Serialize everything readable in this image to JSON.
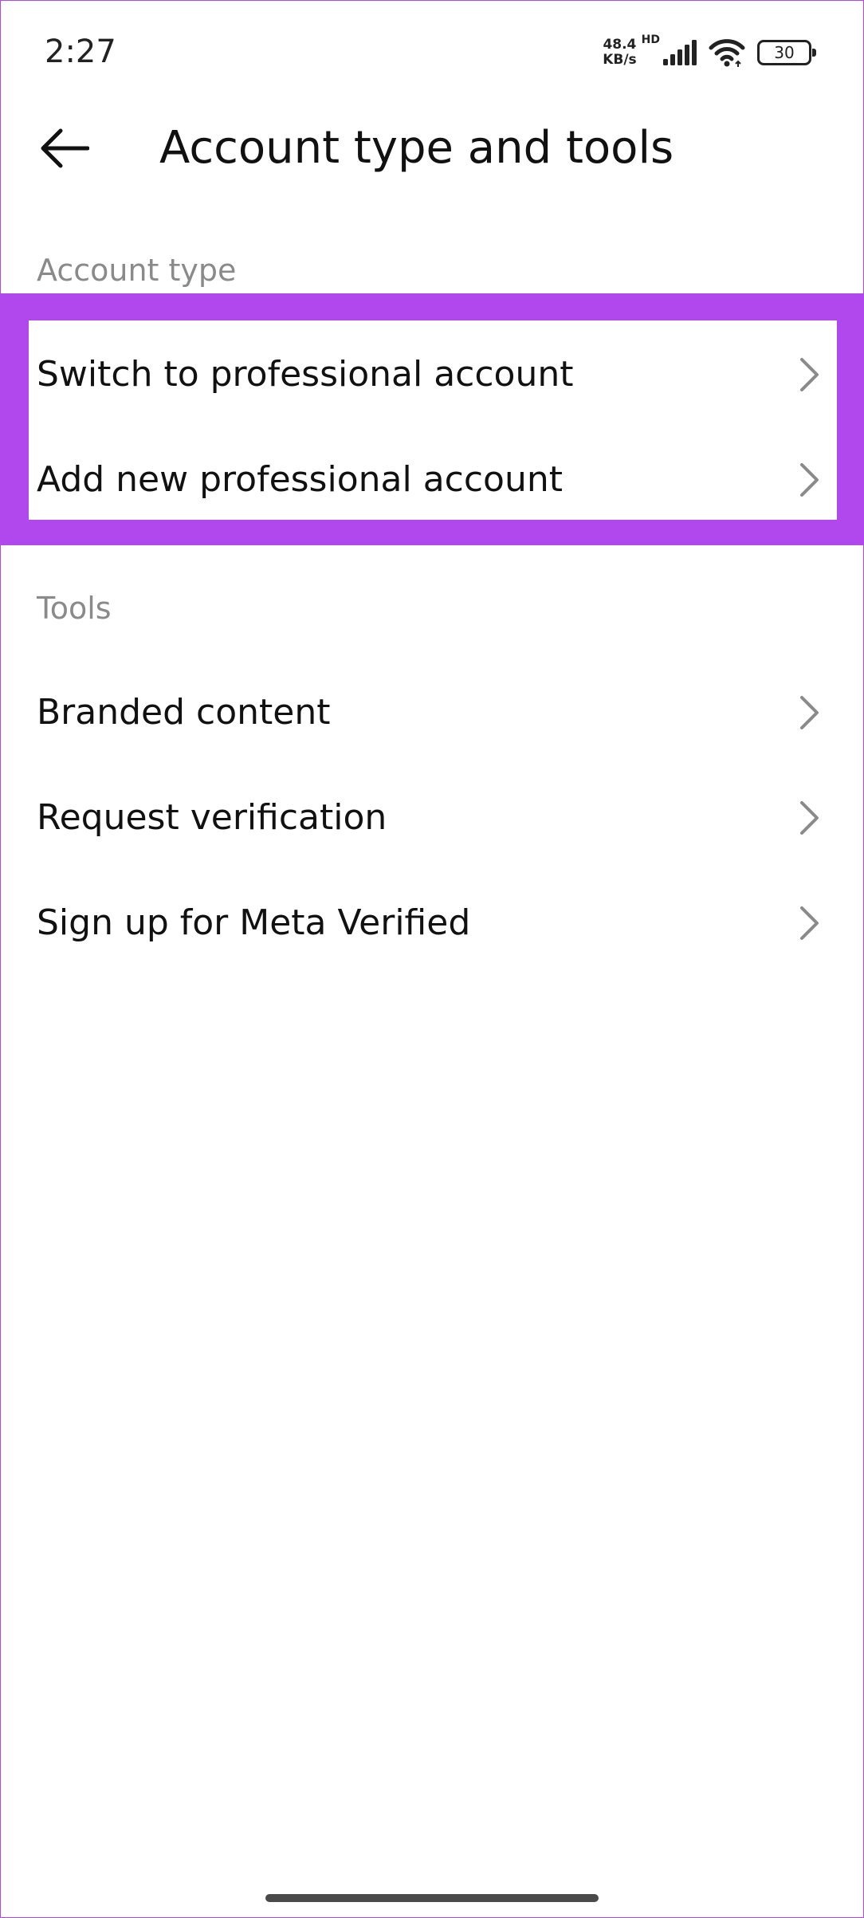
{
  "status_bar": {
    "time": "2:27",
    "speed_value": "48.4",
    "speed_unit": "KB/s",
    "network_type": "HD",
    "battery": "30"
  },
  "header": {
    "title": "Account type and tools",
    "back_icon": "arrow-left-icon"
  },
  "sections": {
    "account_type": {
      "label": "Account type",
      "items": [
        {
          "label": "Switch to professional account"
        },
        {
          "label": "Add new professional account"
        }
      ]
    },
    "tools": {
      "label": "Tools",
      "items": [
        {
          "label": "Branded content"
        },
        {
          "label": "Request verification"
        },
        {
          "label": "Sign up for Meta Verified"
        }
      ]
    }
  },
  "colors": {
    "highlight": "#b048ee",
    "section_header": "#8a8a8a",
    "chevron": "#8a8a8a"
  }
}
